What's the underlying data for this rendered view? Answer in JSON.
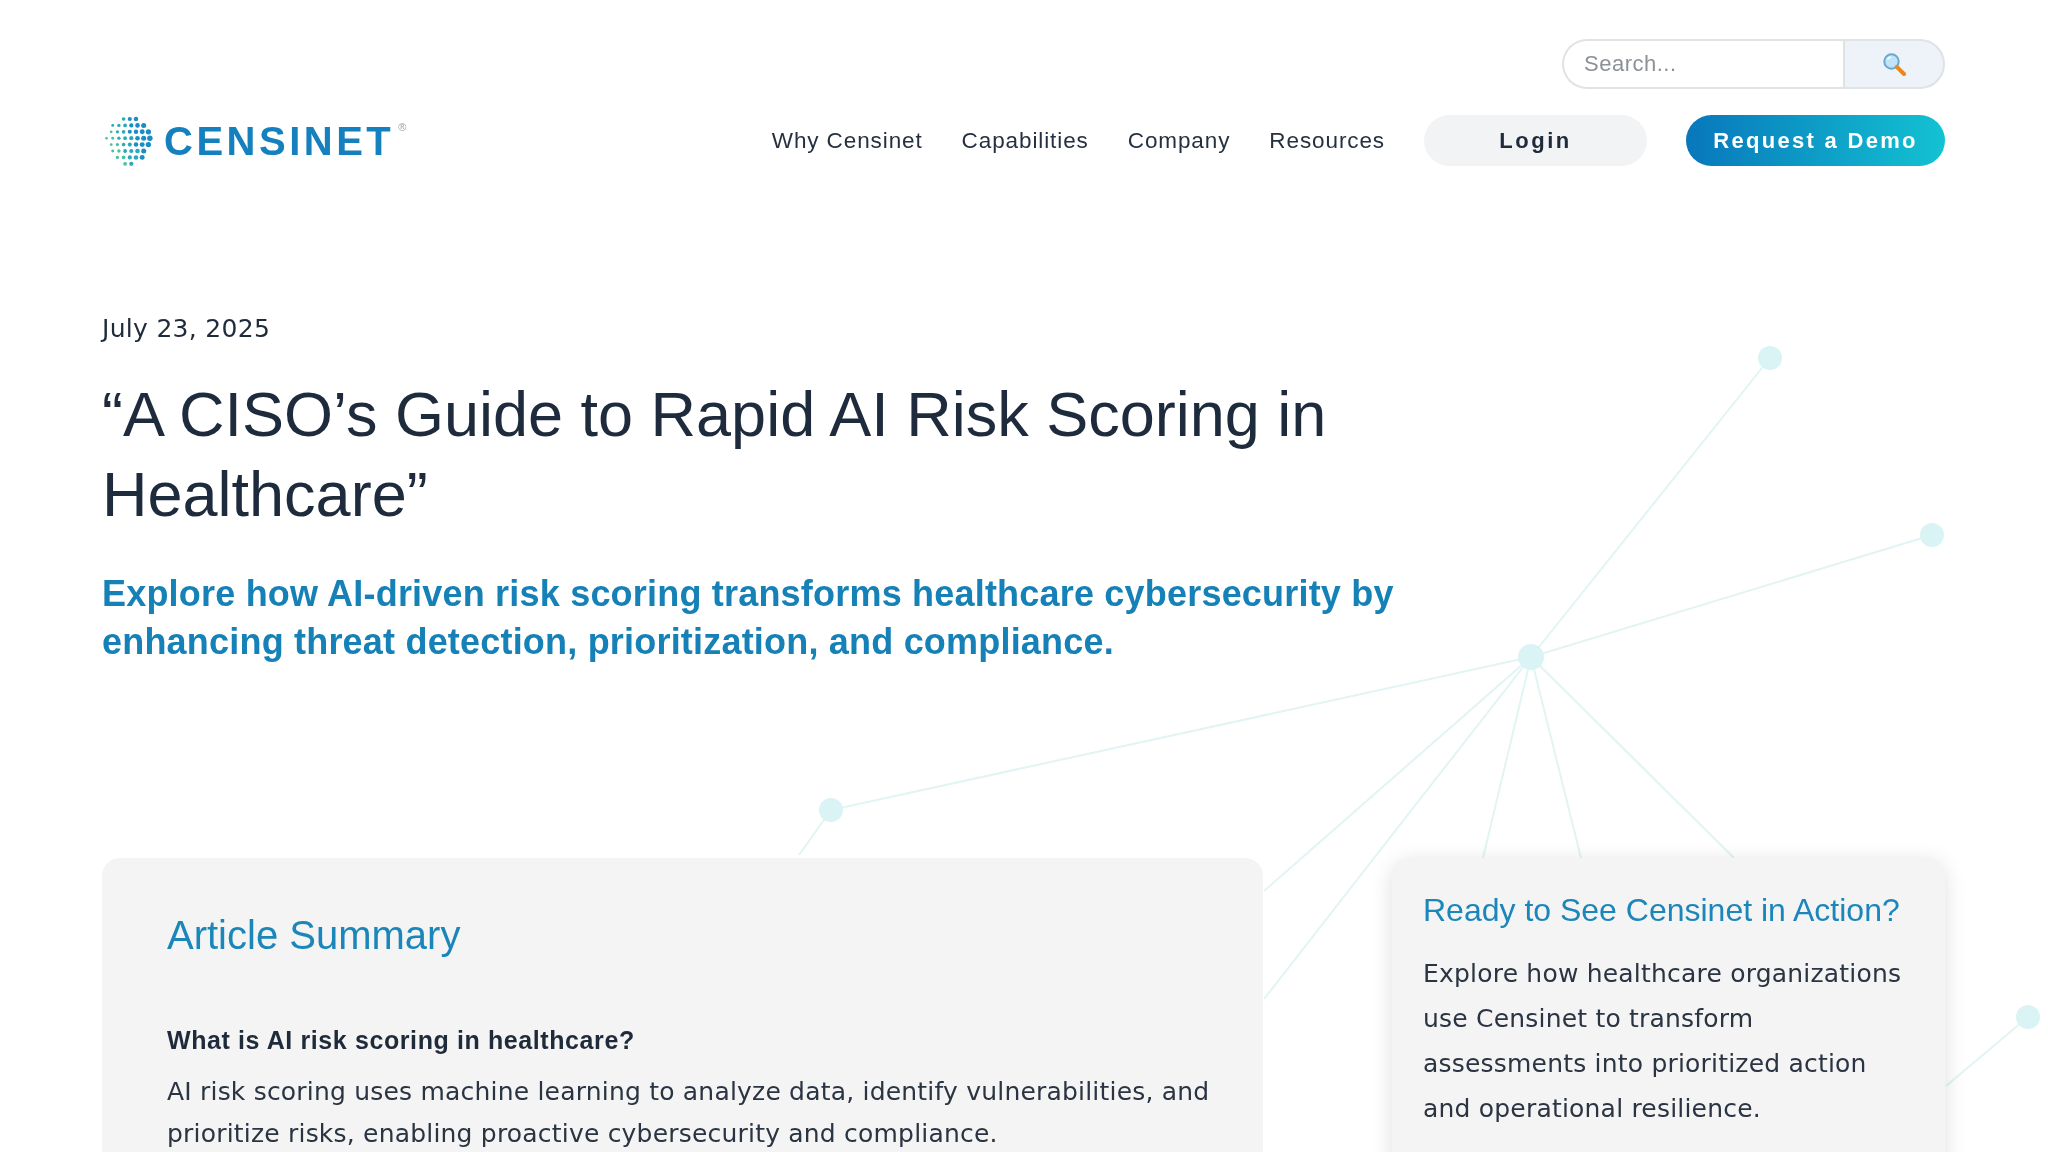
{
  "header": {
    "search": {
      "placeholder": "Search..."
    },
    "logo": {
      "wordmark": "CENSINET",
      "registered": "®"
    },
    "nav": [
      "Why Censinet",
      "Capabilities",
      "Company",
      "Resources"
    ],
    "login": "Login",
    "cta": "Request a Demo"
  },
  "article": {
    "date": "July 23, 2025",
    "title": "“A CISO’s Guide to Rapid AI Risk Scoring in Healthcare”",
    "subtitle": "Explore how AI-driven risk scoring transforms healthcare cybersecurity by enhancing threat detection, prioritization, and compliance."
  },
  "summary": {
    "heading": "Article Summary",
    "question": "What is AI risk scoring in healthcare?",
    "answer": "AI risk scoring uses machine learning to analyze data, identify vulnerabilities, and prioritize risks, enabling proactive cybersecurity and compliance."
  },
  "cta_card": {
    "heading": "Ready to See Censinet in Action?",
    "body": "Explore how healthcare organizations use Censinet to transform assessments into prioritized action and operational resilience."
  }
}
